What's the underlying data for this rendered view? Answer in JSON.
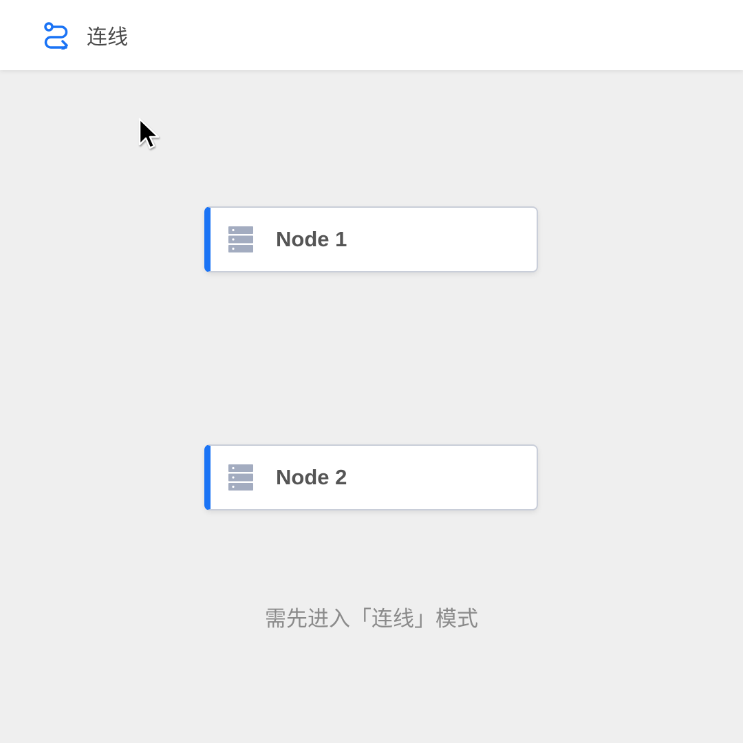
{
  "toolbar": {
    "connect_tool": {
      "label": "连线",
      "icon": "route-connect-icon",
      "accent_color": "#1a73f5"
    }
  },
  "canvas": {
    "nodes": [
      {
        "label": "Node 1",
        "icon": "server-icon"
      },
      {
        "label": "Node 2",
        "icon": "server-icon"
      }
    ],
    "hint": "需先进入「连线」模式",
    "node_accent_color": "#1a73f5",
    "node_icon_color": "#a3acc0"
  },
  "pointer": {
    "icon": "mouse-pointer-icon"
  }
}
